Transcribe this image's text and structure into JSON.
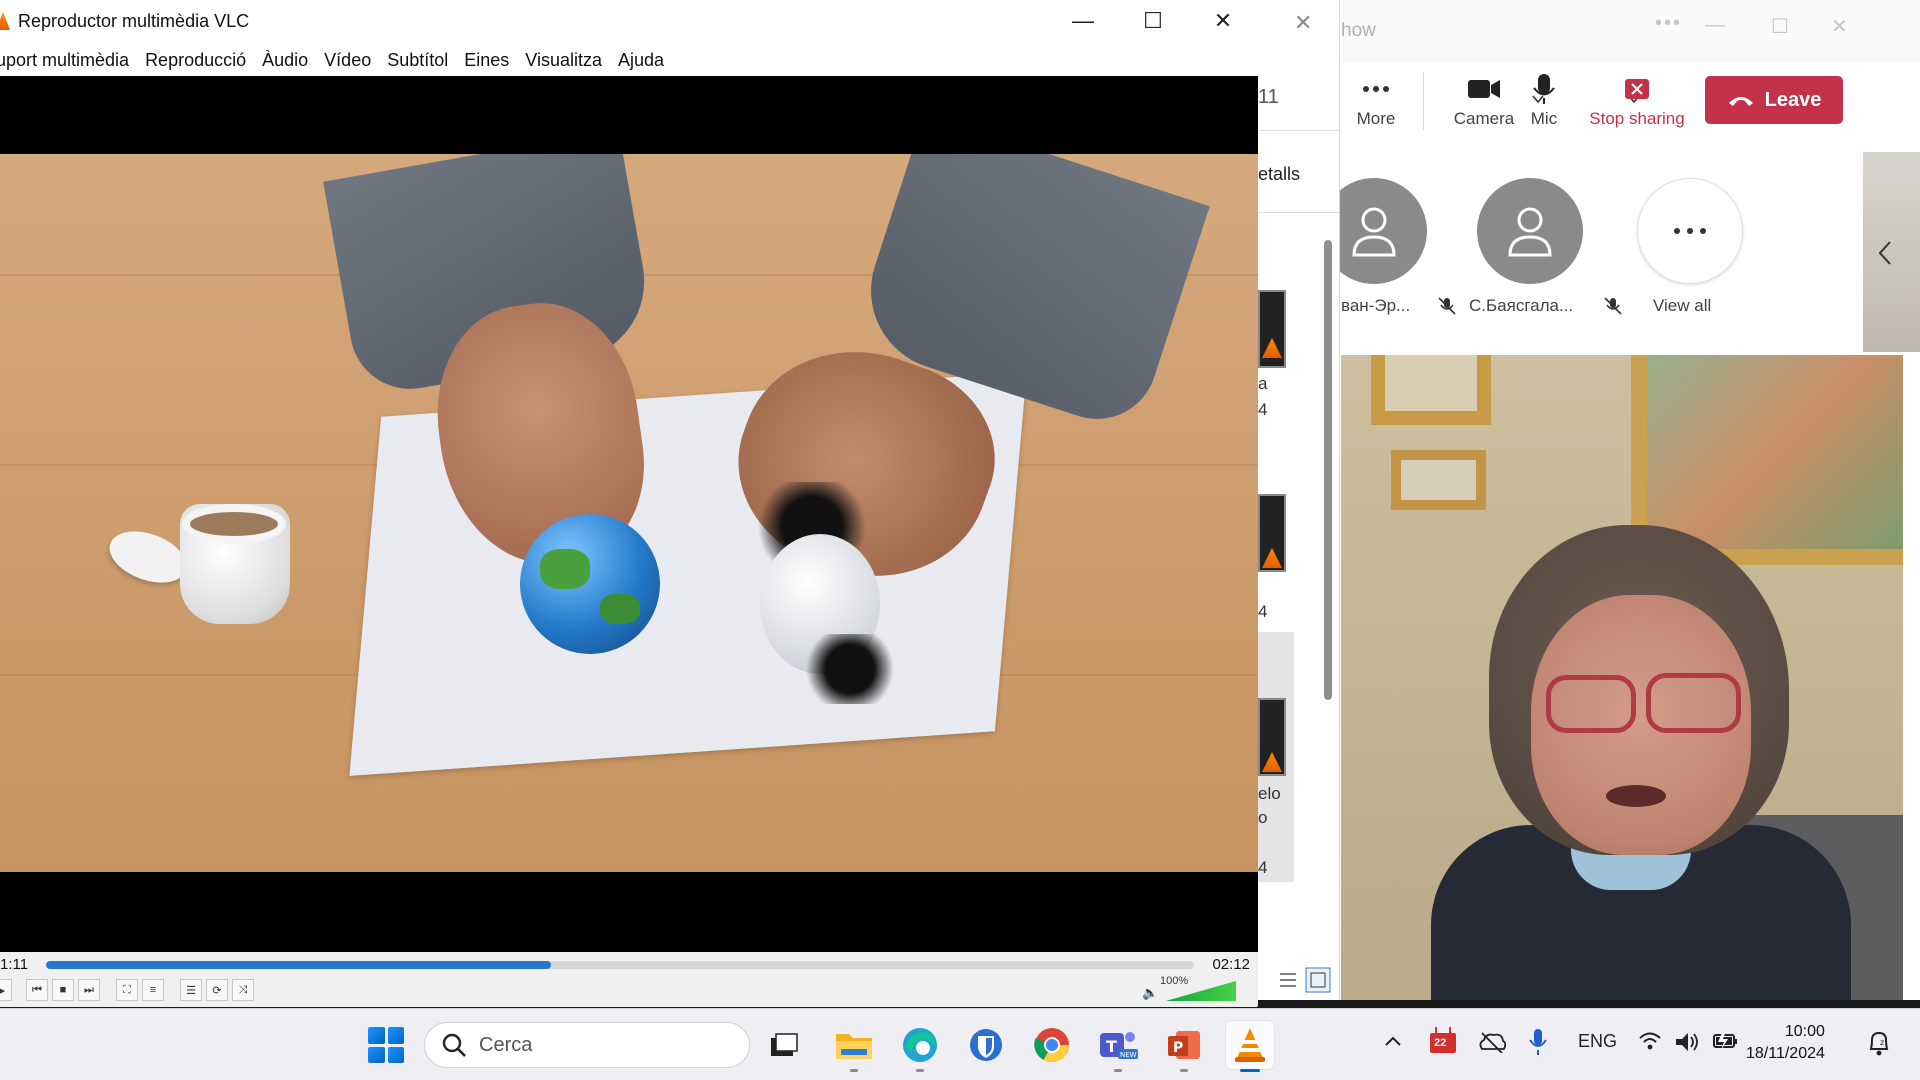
{
  "teams": {
    "window_title_fragment": "how",
    "toolbar": {
      "more_label": "More",
      "camera_label": "Camera",
      "mic_label": "Mic",
      "stop_sharing_label": "Stop sharing",
      "leave_label": "Leave"
    },
    "participants": [
      {
        "name": "ван-Эр..."
      },
      {
        "name": "С.Баясгала..."
      }
    ],
    "view_all_label": "View all",
    "accent_color": "#c4314b"
  },
  "explorer": {
    "header_fragment": "11",
    "details_fragment": "etalls",
    "items": [
      {
        "line1": "a",
        "line2": "4"
      },
      {
        "line1": "4"
      },
      {
        "line1": "elo",
        "line2": "o",
        "line3": "4"
      }
    ]
  },
  "vlc": {
    "window_title": "Reproductor multimèdia VLC",
    "menu": [
      "uport multimèdia",
      "Reproducció",
      "Àudio",
      "Vídeo",
      "Subtítol",
      "Eines",
      "Visualitza",
      "Ajuda"
    ],
    "time_elapsed": "1:11",
    "time_total": "02:12",
    "progress_fraction": 0.44,
    "volume_label": "100%",
    "volume_fraction": 1.0
  },
  "taskbar": {
    "search_placeholder": "Cerca",
    "apps": [
      "file-explorer",
      "edge",
      "bitwarden",
      "chrome",
      "teams-new",
      "powerpoint",
      "vlc"
    ],
    "tray": {
      "calendar_badge": "22",
      "language": "ENG",
      "time": "10:00",
      "date": "18/11/2024"
    }
  }
}
